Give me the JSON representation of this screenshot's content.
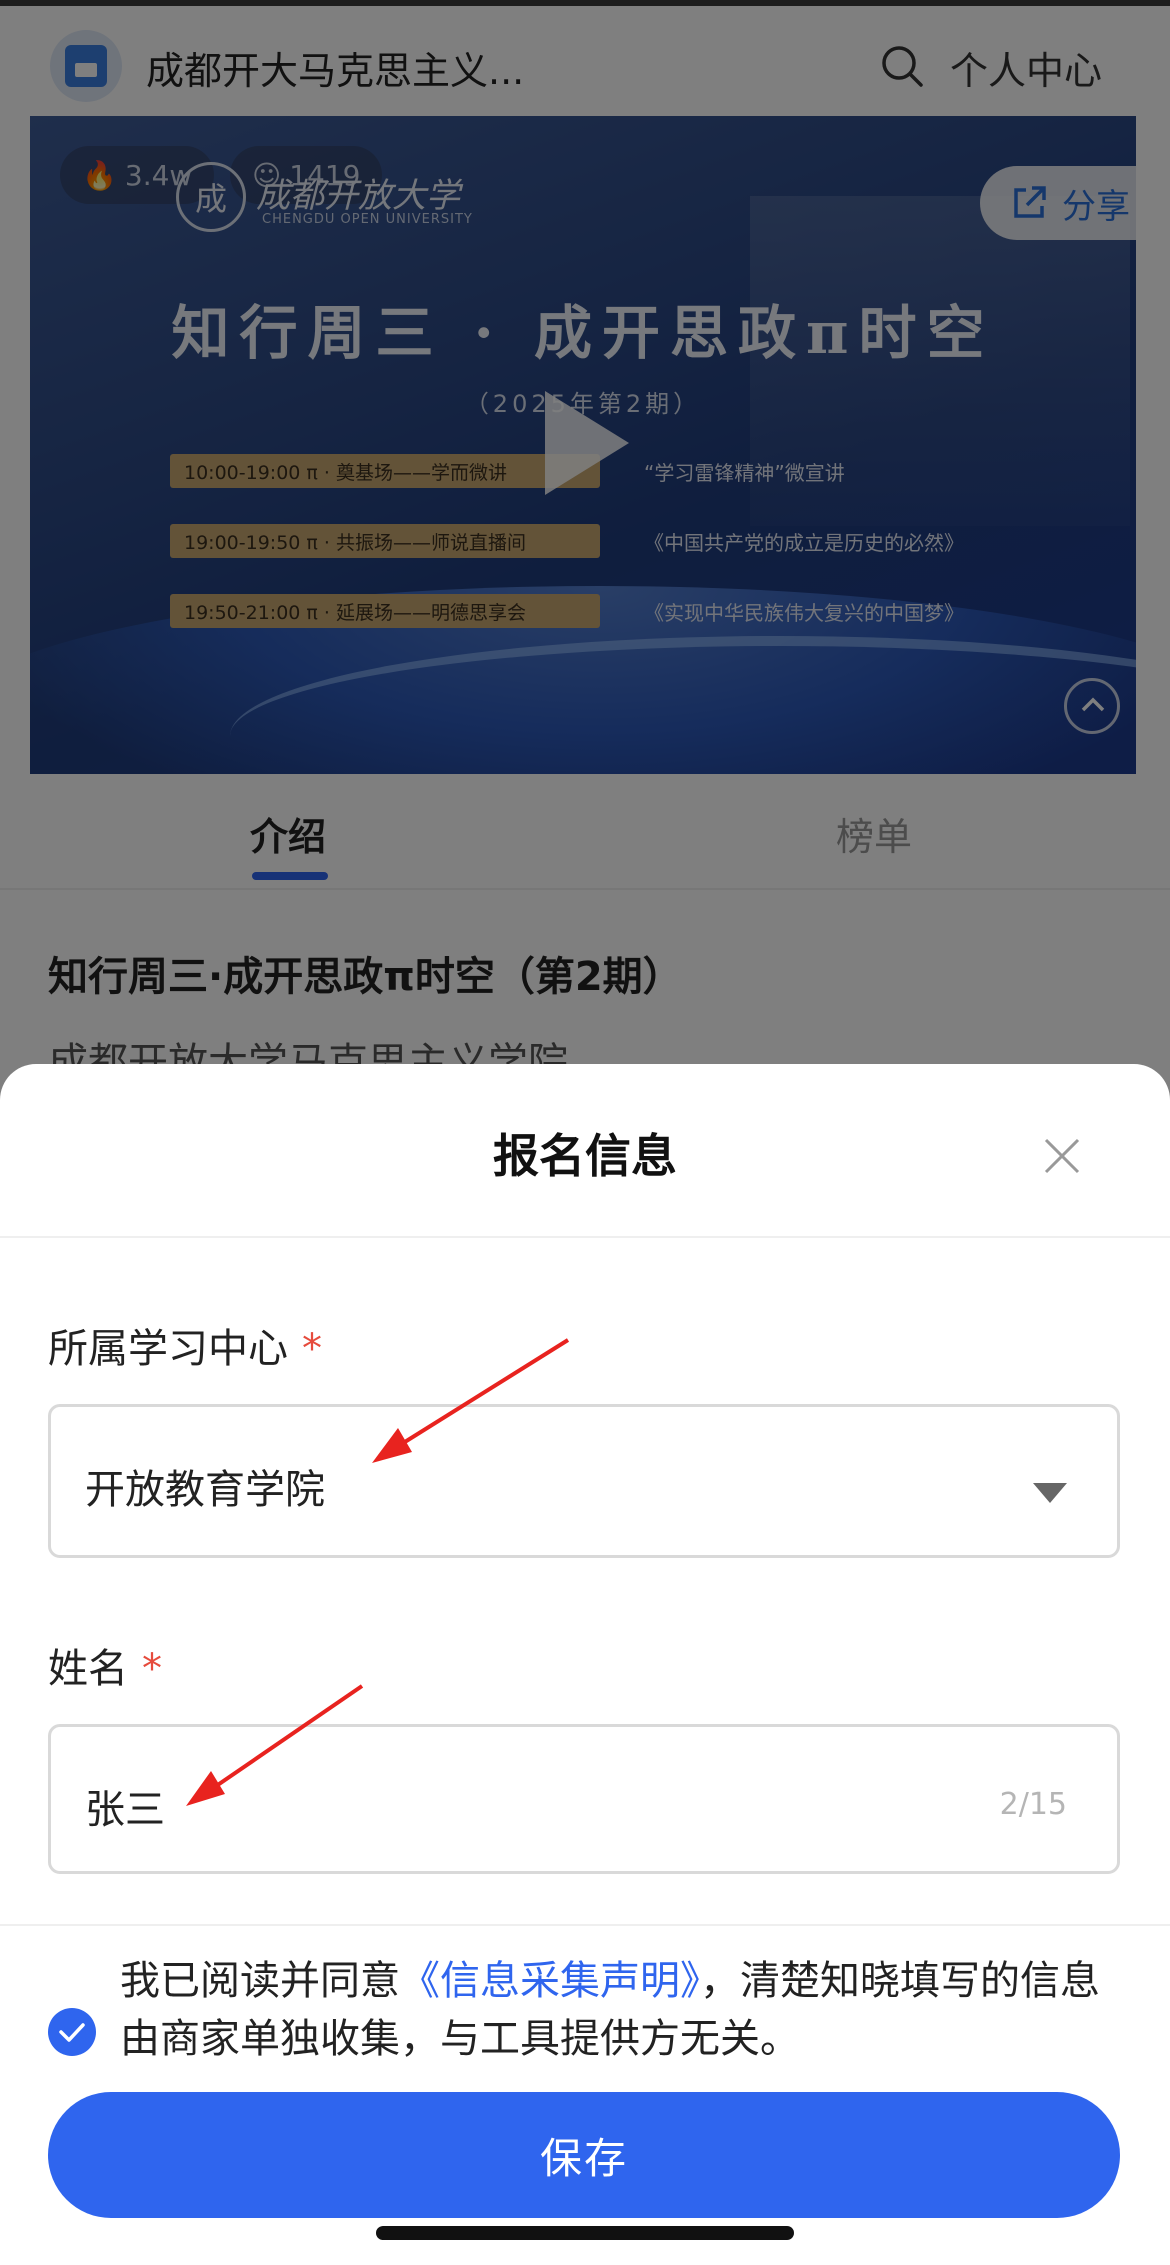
{
  "header": {
    "app_title": "成都开大马克思主义...",
    "personal_center": "个人中心"
  },
  "banner": {
    "views": "3.4w",
    "participants": "1419",
    "university_name": "成都开放大学",
    "university_name_en": "CHENGDU OPEN UNIVERSITY",
    "share_label": "分享",
    "title": "知行周三 · 成开思政π时空",
    "issue": "（2025年第2期）",
    "schedule": [
      {
        "time": "10:00-19:00  π · 奠基场——学而微讲",
        "topic": "“学习雷锋精神”微宣讲"
      },
      {
        "time": "19:00-19:50  π · 共振场——师说直播间",
        "topic": "《中国共产党的成立是历史的必然》"
      },
      {
        "time": "19:50-21:00  π · 延展场——明德思享会",
        "topic": "《实现中华民族伟大复兴的中国梦》"
      }
    ]
  },
  "tabs": [
    {
      "label": "介绍",
      "active": true
    },
    {
      "label": "榜单",
      "active": false
    }
  ],
  "detail": {
    "title": "知行周三·成开思政π时空（第2期）",
    "subtitle": "成都开放大学马克思主义学院"
  },
  "sheet": {
    "title": "报名信息",
    "fields": [
      {
        "label": "所属学习中心",
        "required_mark": "*",
        "value": "开放教育学院"
      },
      {
        "label": "姓名",
        "required_mark": "*",
        "value": "张三",
        "char_count": "2/15"
      }
    ],
    "agreement": {
      "prefix": "我已阅读并同意",
      "link": "《信息采集声明》",
      "suffix": "，清楚知晓填写的信息由商家单独收集，与工具提供方无关。"
    },
    "save_label": "保存"
  },
  "colors": {
    "primary": "#2f65ee",
    "required": "#e64b3c",
    "annotation_arrow": "#e8231f"
  },
  "icons": [
    "search-icon",
    "close-icon",
    "dropdown-icon",
    "check-icon",
    "share-icon",
    "play-icon",
    "chevron-up-icon",
    "fire-icon",
    "people-icon"
  ]
}
